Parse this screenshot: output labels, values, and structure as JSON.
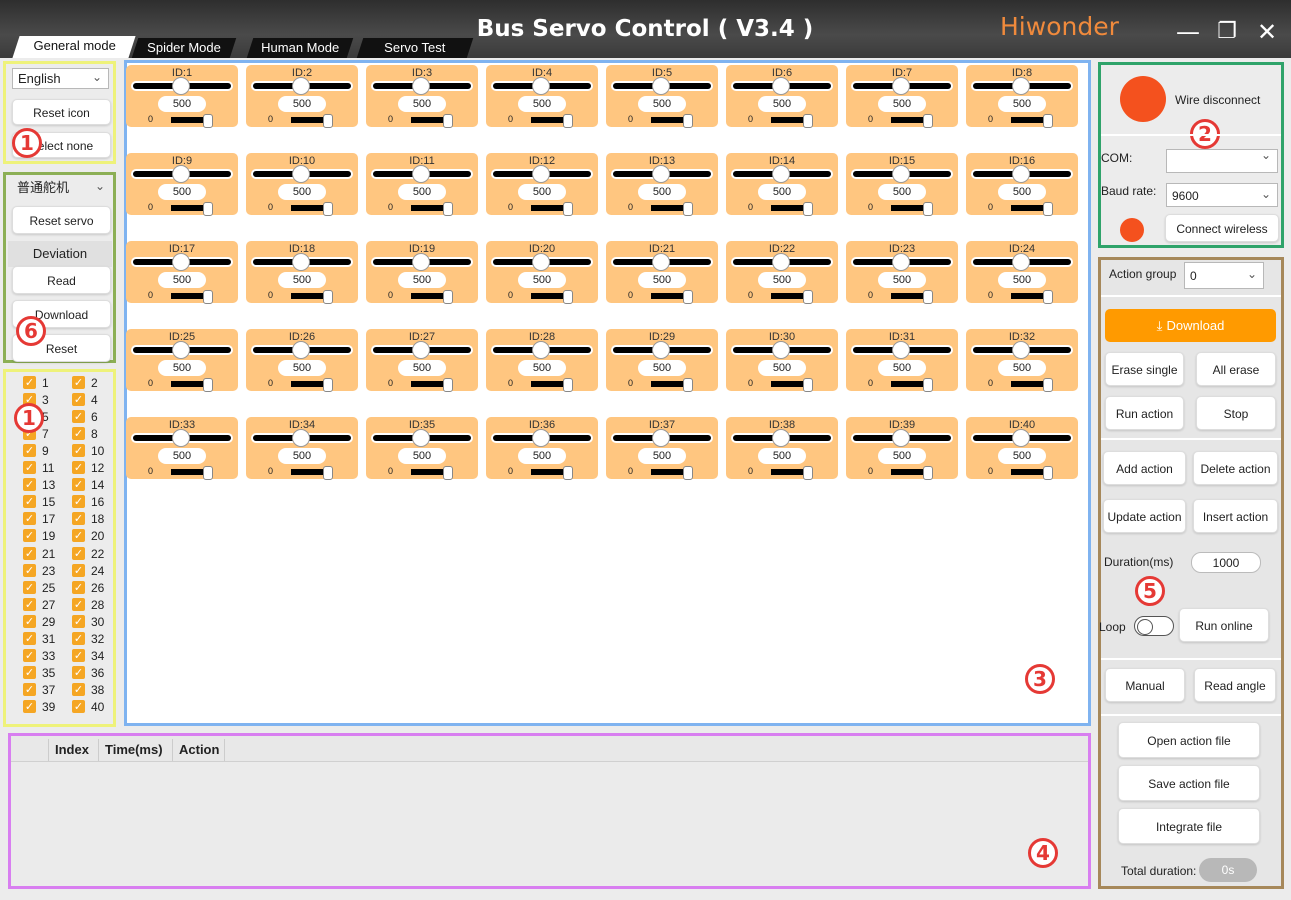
{
  "window": {
    "title": "Bus Servo Control ( V3.4 )",
    "brand": "Hiwonder",
    "minimize": "—",
    "maximize": "❐",
    "close": "✕"
  },
  "tabs": [
    "General mode",
    "Spider Mode",
    "Human Mode",
    "Servo Test"
  ],
  "left": {
    "language": "English",
    "reset_icon": "Reset icon",
    "select_none": "Select none",
    "servo_type": "普通舵机",
    "reset_servo": "Reset servo",
    "deviation": "Deviation",
    "read": "Read",
    "download": "Download",
    "reset": "Reset"
  },
  "badges": {
    "b1": "1",
    "b2": "2",
    "b3": "3",
    "b4": "4",
    "b5": "5",
    "b6": "6"
  },
  "servo_checkboxes": [
    "1",
    "2",
    "3",
    "4",
    "5",
    "6",
    "7",
    "8",
    "9",
    "10",
    "11",
    "12",
    "13",
    "14",
    "15",
    "16",
    "17",
    "18",
    "19",
    "20",
    "21",
    "22",
    "23",
    "24",
    "25",
    "26",
    "27",
    "28",
    "29",
    "30",
    "31",
    "32",
    "33",
    "34",
    "35",
    "36",
    "37",
    "38",
    "39",
    "40"
  ],
  "servos": [
    {
      "id": "ID:1",
      "value": "500",
      "min": "0"
    },
    {
      "id": "ID:2",
      "value": "500",
      "min": "0"
    },
    {
      "id": "ID:3",
      "value": "500",
      "min": "0"
    },
    {
      "id": "ID:4",
      "value": "500",
      "min": "0"
    },
    {
      "id": "ID:5",
      "value": "500",
      "min": "0"
    },
    {
      "id": "ID:6",
      "value": "500",
      "min": "0"
    },
    {
      "id": "ID:7",
      "value": "500",
      "min": "0"
    },
    {
      "id": "ID:8",
      "value": "500",
      "min": "0"
    },
    {
      "id": "ID:9",
      "value": "500",
      "min": "0"
    },
    {
      "id": "ID:10",
      "value": "500",
      "min": "0"
    },
    {
      "id": "ID:11",
      "value": "500",
      "min": "0"
    },
    {
      "id": "ID:12",
      "value": "500",
      "min": "0"
    },
    {
      "id": "ID:13",
      "value": "500",
      "min": "0"
    },
    {
      "id": "ID:14",
      "value": "500",
      "min": "0"
    },
    {
      "id": "ID:15",
      "value": "500",
      "min": "0"
    },
    {
      "id": "ID:16",
      "value": "500",
      "min": "0"
    },
    {
      "id": "ID:17",
      "value": "500",
      "min": "0"
    },
    {
      "id": "ID:18",
      "value": "500",
      "min": "0"
    },
    {
      "id": "ID:19",
      "value": "500",
      "min": "0"
    },
    {
      "id": "ID:20",
      "value": "500",
      "min": "0"
    },
    {
      "id": "ID:21",
      "value": "500",
      "min": "0"
    },
    {
      "id": "ID:22",
      "value": "500",
      "min": "0"
    },
    {
      "id": "ID:23",
      "value": "500",
      "min": "0"
    },
    {
      "id": "ID:24",
      "value": "500",
      "min": "0"
    },
    {
      "id": "ID:25",
      "value": "500",
      "min": "0"
    },
    {
      "id": "ID:26",
      "value": "500",
      "min": "0"
    },
    {
      "id": "ID:27",
      "value": "500",
      "min": "0"
    },
    {
      "id": "ID:28",
      "value": "500",
      "min": "0"
    },
    {
      "id": "ID:29",
      "value": "500",
      "min": "0"
    },
    {
      "id": "ID:30",
      "value": "500",
      "min": "0"
    },
    {
      "id": "ID:31",
      "value": "500",
      "min": "0"
    },
    {
      "id": "ID:32",
      "value": "500",
      "min": "0"
    },
    {
      "id": "ID:33",
      "value": "500",
      "min": "0"
    },
    {
      "id": "ID:34",
      "value": "500",
      "min": "0"
    },
    {
      "id": "ID:35",
      "value": "500",
      "min": "0"
    },
    {
      "id": "ID:36",
      "value": "500",
      "min": "0"
    },
    {
      "id": "ID:37",
      "value": "500",
      "min": "0"
    },
    {
      "id": "ID:38",
      "value": "500",
      "min": "0"
    },
    {
      "id": "ID:39",
      "value": "500",
      "min": "0"
    },
    {
      "id": "ID:40",
      "value": "500",
      "min": "0"
    }
  ],
  "table": {
    "headers": [
      "Index",
      "Time(ms)",
      "Action"
    ]
  },
  "connection": {
    "status": "Wire disconnect",
    "com_label": "COM:",
    "com_value": "",
    "baud_label": "Baud rate:",
    "baud_value": "9600",
    "connect_wireless": "Connect wireless",
    "status_color": "#f4511e"
  },
  "actions": {
    "group_label": "Action group",
    "group_value": "0",
    "download": "Download",
    "erase_single": "Erase single",
    "all_erase": "All erase",
    "run_action": "Run action",
    "stop": "Stop",
    "add_action": "Add action",
    "delete_action": "Delete action",
    "update_action": "Update action",
    "insert_action": "Insert action",
    "duration_label": "Duration(ms)",
    "duration_value": "1000",
    "loop_label": "Loop",
    "run_online": "Run online",
    "manual": "Manual",
    "read_angle": "Read angle",
    "open_file": "Open action file",
    "save_file": "Save action file",
    "integrate_file": "Integrate file",
    "total_label": "Total duration:",
    "total_value": "0s"
  },
  "colors": {
    "accent": "#ff9a00",
    "card": "#ffc680",
    "status_red": "#f4511e"
  }
}
